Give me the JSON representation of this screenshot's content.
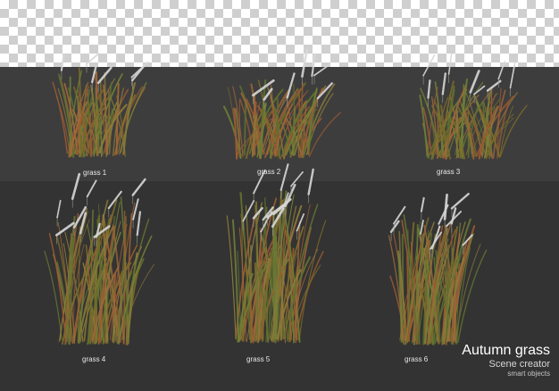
{
  "colors": {
    "top_panel": "#3d3d3d",
    "bottom_panel": "#333333",
    "stem_green": "#6f7f35",
    "stem_olive": "#8a7a3a",
    "stem_rust": "#9a5a32",
    "plume": "#d8d8d8"
  },
  "items": [
    {
      "label": "grass 1"
    },
    {
      "label": "grass 2"
    },
    {
      "label": "grass 3"
    },
    {
      "label": "grass 4"
    },
    {
      "label": "grass 5"
    },
    {
      "label": "grass 6"
    }
  ],
  "brand": {
    "title": "Autumn grass",
    "subtitle": "Scene creator",
    "note": "smart objects"
  }
}
